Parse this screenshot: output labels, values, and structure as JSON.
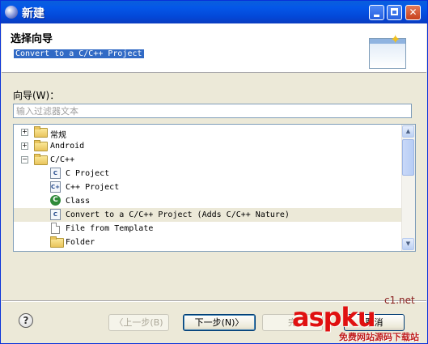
{
  "window": {
    "title": "新建"
  },
  "banner": {
    "title": "选择向导",
    "description": "Convert to a C/C++ Project"
  },
  "wizard": {
    "label": "向导(W)：",
    "filter_placeholder": "输入过滤器文本"
  },
  "tree": {
    "items": [
      {
        "label": "常规",
        "type": "folder",
        "expanded": false
      },
      {
        "label": "Android",
        "type": "folder",
        "expanded": false
      },
      {
        "label": "C/C++",
        "type": "folder",
        "expanded": true
      },
      {
        "label": "C Project",
        "type": "c-project"
      },
      {
        "label": "C++ Project",
        "type": "cpp-project"
      },
      {
        "label": "Class",
        "type": "class"
      },
      {
        "label": "Convert to a C/C++ Project (Adds C/C++ Nature)",
        "type": "convert",
        "selected": true
      },
      {
        "label": "File from Template",
        "type": "file"
      },
      {
        "label": "Folder",
        "type": "folder"
      }
    ]
  },
  "buttons": {
    "back": "〈上一步(B)",
    "next": "下一步(N)〉",
    "finish": "完",
    "cancel": "取消"
  },
  "watermark": {
    "main": "aspku",
    "suffix": "c1.net",
    "sub": "免费网站源码下载站"
  }
}
